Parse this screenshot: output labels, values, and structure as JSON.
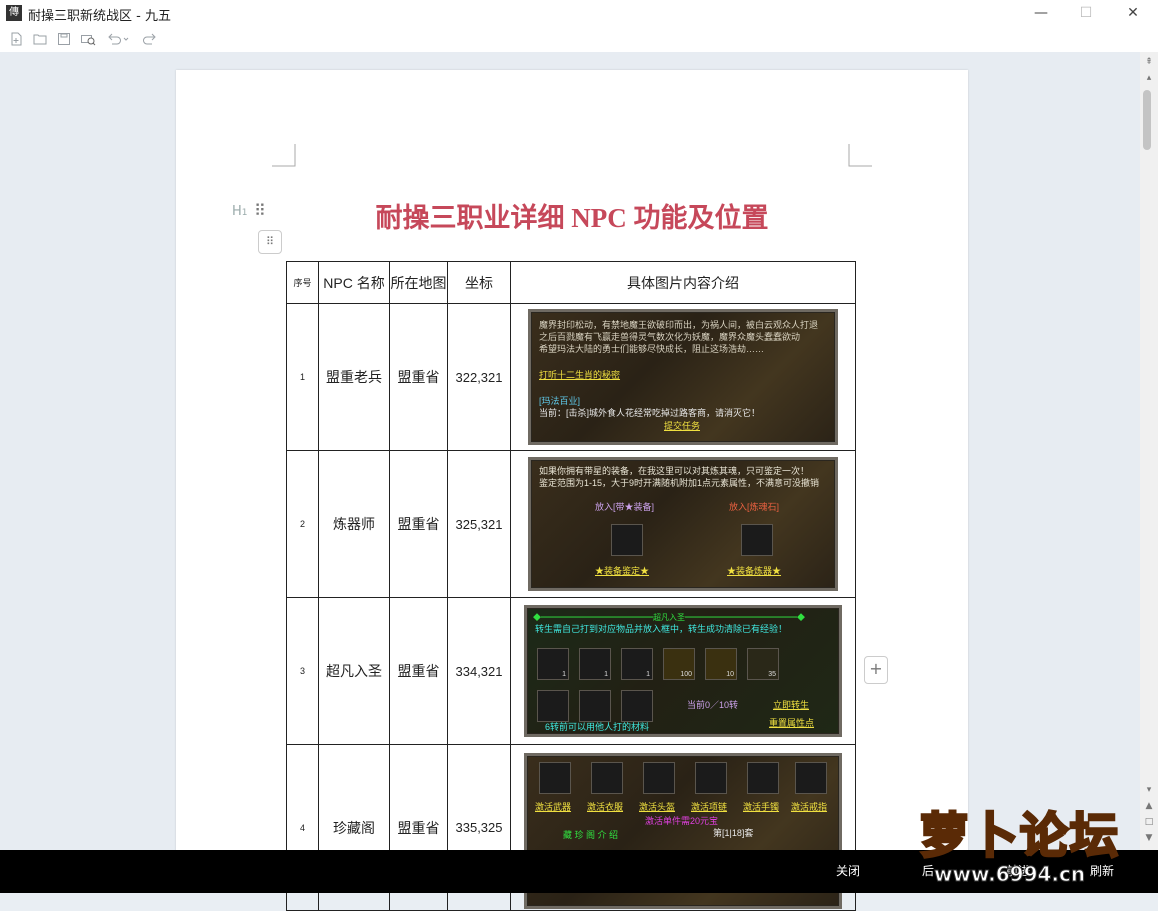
{
  "window": {
    "title": "耐操三职新统战区 - 九五",
    "app_icon_glyph": "傳",
    "controls": {
      "minimize": "—",
      "maximize": "☐",
      "close": "✕"
    }
  },
  "toolbar": {
    "icons": [
      "new-doc-icon",
      "open-folder-icon",
      "save-icon",
      "print-preview-icon",
      "undo-icon",
      "redo-icon"
    ]
  },
  "document": {
    "heading_marker": "H",
    "title": "耐操三职业详细 NPC 功能及位置",
    "table": {
      "headers": {
        "seq": "序号",
        "name": "NPC 名称",
        "map": "所在地图",
        "coord": "坐标",
        "detail": "具体图片内容介绍"
      },
      "rows": [
        {
          "seq": "1",
          "name": "盟重老兵",
          "map": "盟重省",
          "coord": "322,321"
        },
        {
          "seq": "2",
          "name": "炼器师",
          "map": "盟重省",
          "coord": "325,321"
        },
        {
          "seq": "3",
          "name": "超凡入圣",
          "map": "盟重省",
          "coord": "334,321"
        },
        {
          "seq": "4",
          "name": "珍藏阁",
          "map": "盟重省",
          "coord": "335,325"
        }
      ]
    },
    "screenshots": {
      "s1": {
        "lines": [
          "魔界封印松动，有禁地魔王欲破印而出，为祸人间，被白云观众人打退",
          "之后百戮魔有飞赢走兽得灵气数次化为妖魔，魔界众魔头蠢蠢欲动",
          "希望玛法大陆的勇士们能够尽快成长，阻止这场浩劫……"
        ],
        "quest": "打听十二生肖的秘密",
        "tag": "[玛法百业]",
        "current": "当前：[击杀]城外食人花经常吃掉过路客商，请消灭它！",
        "submit": "提交任务"
      },
      "s2": {
        "lines": [
          "如果你拥有带星的装备，在我这里可以对其炼其魂，只可鉴定一次！",
          "鉴定范围为1-15，大于9时开满随机附加1点元素属性，不满意可没撤销"
        ],
        "left_label": "放入[带★装备]",
        "right_label": "放入[炼魂石]",
        "left_btn": "★装备鉴定★",
        "right_btn": "★装备炼器★"
      },
      "s3": {
        "banner": "◆━━━━━━━━━━━━━━超凡入圣━━━━━━━━━━━━━━◆",
        "desc": "转生需自己打到对应物品并放入框中，转生成功清除已有经验！",
        "slots": [
          "1",
          "1",
          "1",
          "100",
          "10",
          "35"
        ],
        "progress": "当前0／10转",
        "btn1": "立即转生",
        "btn2": "重置属性点",
        "note": "6转前可以用他人打的材料"
      },
      "s4": {
        "labels": [
          "激活武器",
          "激活衣服",
          "激活头盔",
          "激活项链",
          "激活手镯",
          "激活戒指"
        ],
        "cost": "激活单件需20元宝",
        "intro": "藏 珍 阁 介 绍",
        "pager": "第[1|18]套"
      }
    }
  },
  "bottom_bar": {
    "close": "关闭",
    "back": "后",
    "forward": "前进",
    "refresh": "刷新"
  },
  "watermark": {
    "logo_text": "萝卜论坛",
    "url": "www.6994.cn"
  }
}
